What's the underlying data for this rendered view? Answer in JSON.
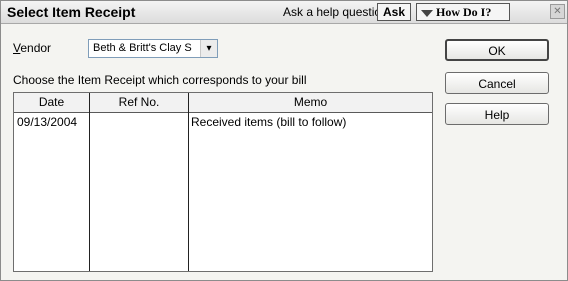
{
  "window": {
    "title": "Select Item Receipt",
    "help_question_label": "Ask a help question",
    "ask_button": "Ask",
    "how_do_i_button": "How Do I?",
    "close_glyph": "✕"
  },
  "vendor": {
    "label_prefix": "",
    "label_access_key": "V",
    "label_rest": "endor",
    "selected_value": "Beth & Britt's Clay S",
    "dropdown_glyph": "▾"
  },
  "instruction": "Choose the Item Receipt which corresponds to your bill",
  "table": {
    "columns": [
      "Date",
      "Ref No.",
      "Memo"
    ],
    "rows": [
      {
        "date": "09/13/2004",
        "ref_no": "",
        "memo": "Received items (bill to follow)"
      }
    ]
  },
  "buttons": {
    "ok": "OK",
    "cancel": "Cancel",
    "help": "Help"
  },
  "icons": {
    "how_do_i": "dropdown-triangle-icon",
    "close": "close-icon",
    "vendor_dropdown": "chevron-down-icon"
  }
}
